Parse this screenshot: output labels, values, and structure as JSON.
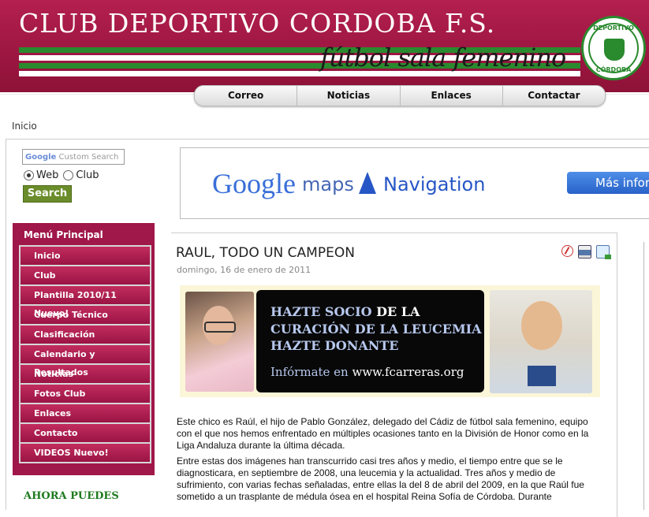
{
  "header": {
    "site_title": "CLUB DEPORTIVO CORDOBA F.S.",
    "subtitle": "fútbol sala femenino",
    "logo_top": "DEPORTIVO",
    "logo_bottom": "CÓRDOBA",
    "colors": {
      "brand": "#9c1641",
      "green": "#2a8a2e"
    }
  },
  "nav": {
    "items": [
      "Correo",
      "Noticias",
      "Enlaces",
      "Contactar"
    ]
  },
  "breadcrumb": "Inicio",
  "search": {
    "placeholder": "Custom Search",
    "google_label": "Google",
    "radio_web": "Web",
    "radio_club": "Club",
    "selected": "Web",
    "button": "Search"
  },
  "menu": {
    "title": "Menú Principal",
    "items": [
      "Inicio",
      "Club",
      "Plantilla 2010/11 Nuevo!",
      "Cuerpo Técnico",
      "Clasificación",
      "Calendario y Resultados",
      "Noticias",
      "Fotos Club",
      "Enlaces",
      "Contacto",
      "VIDEOS Nuevo!"
    ]
  },
  "left_footer": "AHORA PUEDES",
  "ad": {
    "google": "Google",
    "maps": "maps",
    "navigation": "Navigation",
    "button": "Más inform"
  },
  "article": {
    "title": "RAUL, TODO UN CAMPEON",
    "date": "domingo, 16 de enero de 2011",
    "promo": {
      "line1a": "HAZTE SOCIO",
      "line1b": " DE LA",
      "line2": "CURACIÓN DE LA LEUCEMIA",
      "line3": "HAZTE DONANTE",
      "line4a": "Infórmate en ",
      "line4b": "www.fcarreras.org"
    },
    "paragraphs": [
      "Este chico es Raúl, el hijo de Pablo González, delegado del Cádiz de fútbol sala femenino, equipo con el que nos hemos enfrentado en múltiples ocasiones tanto en la División de Honor como en la Liga Andaluza durante la última década.",
      "Entre estas dos imágenes han transcurrido casi tres años y medio, el tiempo entre que se le diagnosticara, en septiembre de 2008, una leucemia y la actualidad. Tres años y medio de sufrimiento, con varias fechas señaladas, entre ellas la del 8 de abril del 2009, en la que Raúl fue sometido a un trasplante de médula ósea en el hospital Reina Sofía de Córdoba. Durante"
    ]
  }
}
